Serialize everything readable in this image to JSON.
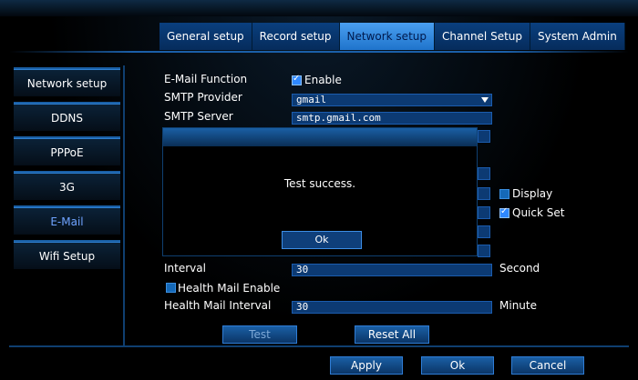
{
  "tabs": [
    {
      "label": "General setup",
      "active": false
    },
    {
      "label": "Record setup",
      "active": false
    },
    {
      "label": "Network setup",
      "active": true
    },
    {
      "label": "Channel Setup",
      "active": false
    },
    {
      "label": "System Admin",
      "active": false
    }
  ],
  "sidebar": {
    "items": [
      {
        "label": "Network setup",
        "active": false
      },
      {
        "label": "DDNS",
        "active": false
      },
      {
        "label": "PPPoE",
        "active": false
      },
      {
        "label": "3G",
        "active": false
      },
      {
        "label": "E-Mail",
        "active": true
      },
      {
        "label": "Wifi Setup",
        "active": false
      }
    ]
  },
  "form": {
    "email_function_label": "E-Mail Function",
    "enable_label": "Enable",
    "enable_checked": true,
    "smtp_provider_label": "SMTP Provider",
    "smtp_provider_value": "gmail",
    "smtp_server_label": "SMTP Server",
    "smtp_server_value": "smtp.gmail.com",
    "display_label": "Display",
    "display_checked": false,
    "quick_set_label": "Quick Set",
    "quick_set_checked": true,
    "interval_label": "Interval",
    "interval_value": "30",
    "interval_unit": "Second",
    "health_mail_enable_label": "Health Mail Enable",
    "health_mail_enable_checked": false,
    "health_mail_interval_label": "Health Mail Interval",
    "health_mail_interval_value": "30",
    "health_mail_interval_unit": "Minute"
  },
  "modal": {
    "message": "Test success.",
    "ok_label": "Ok"
  },
  "actions": {
    "test_label": "Test",
    "reset_all_label": "Reset All"
  },
  "footer": {
    "apply_label": "Apply",
    "ok_label": "Ok",
    "cancel_label": "Cancel"
  },
  "colors": {
    "accent": "#1f74cc",
    "active_tab": "#4a9ff0",
    "field_bg": "#0c3a73",
    "background": "#000000"
  }
}
